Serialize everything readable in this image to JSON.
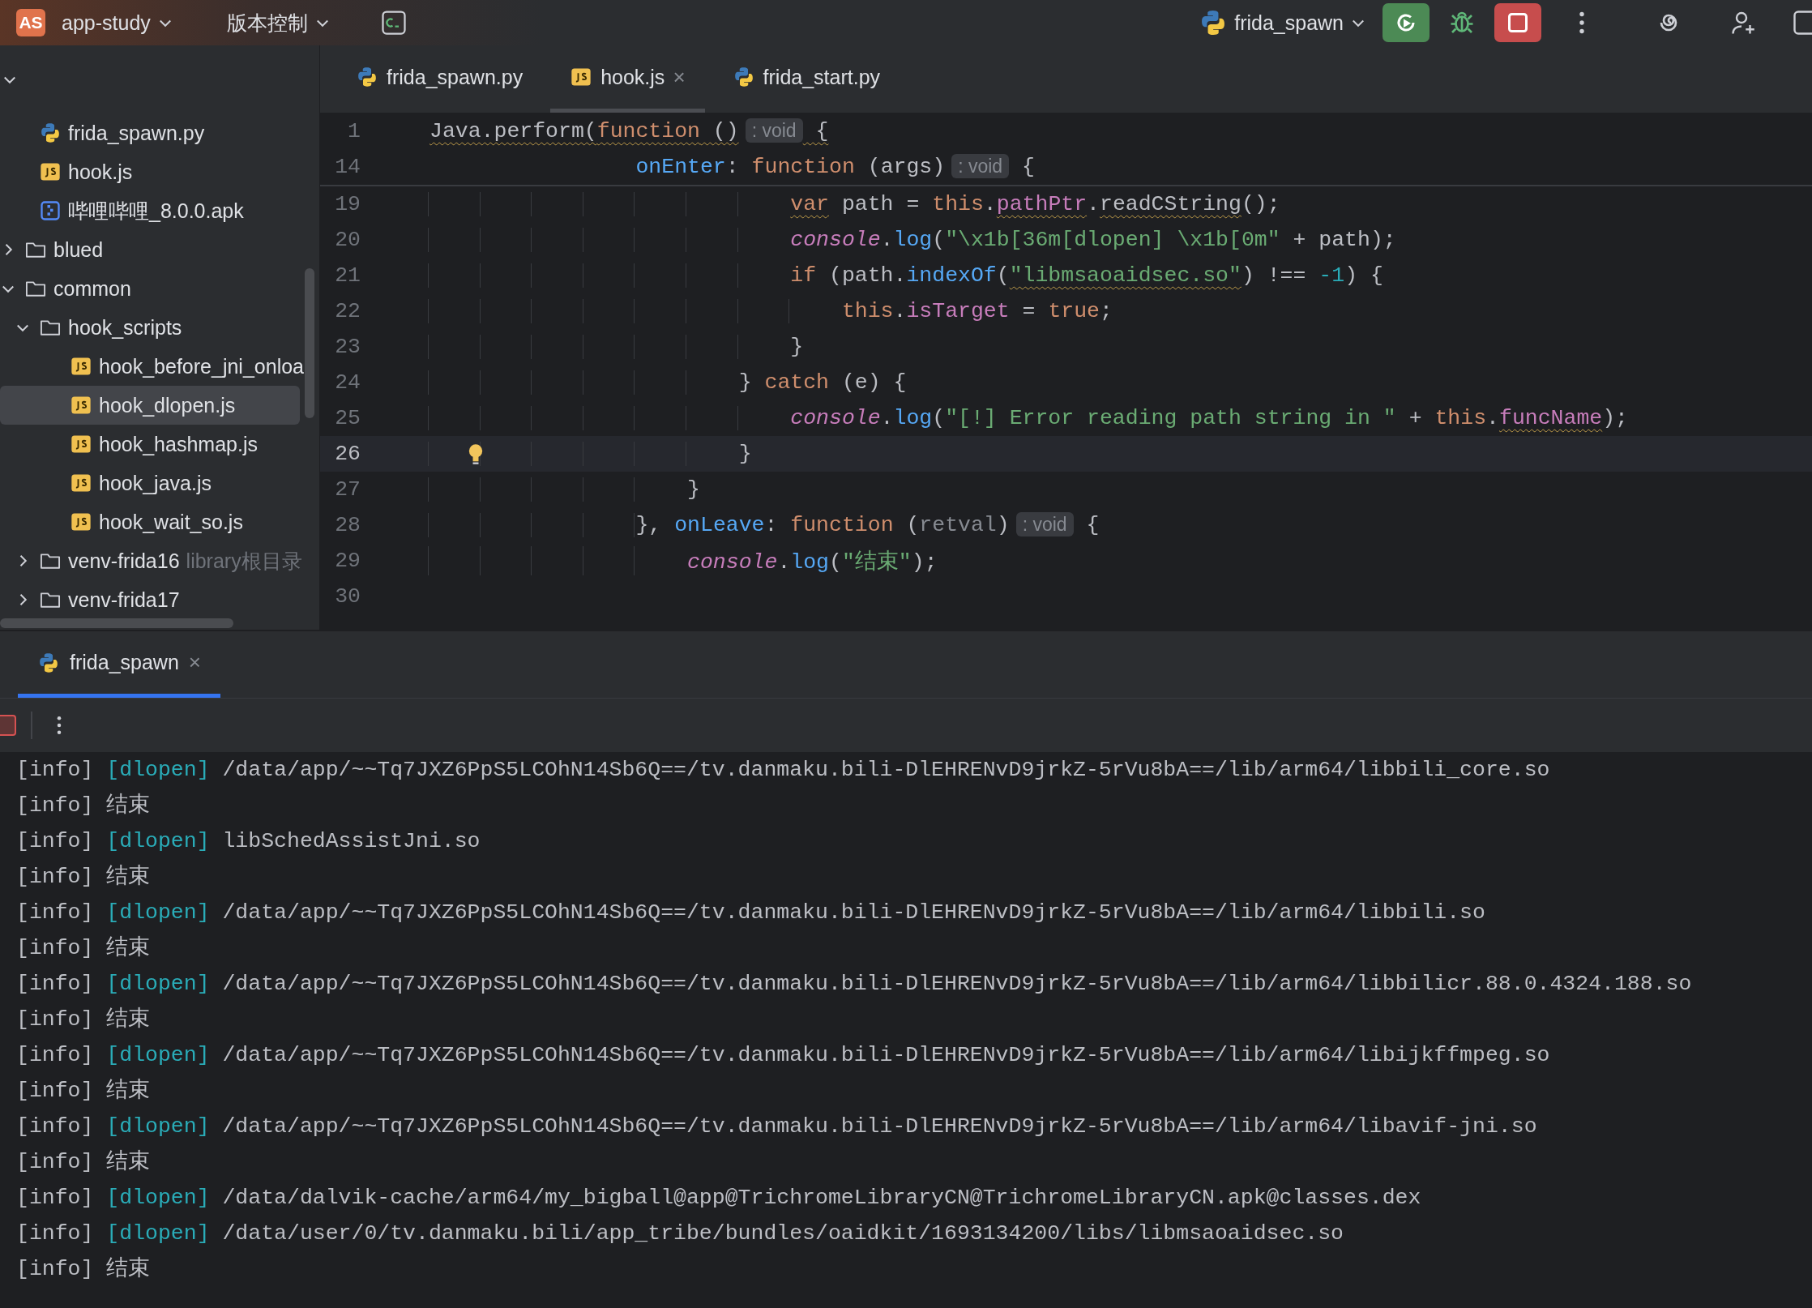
{
  "toolbar": {
    "project_badge": "AS",
    "project": "app-study",
    "vcs": "版本控制",
    "run_config": "frida_spawn"
  },
  "sidebar": {
    "tree": [
      {
        "children": [
          {
            "label": "frida_spawn.py",
            "kind": "python",
            "selected": false
          },
          {
            "label": "hook.js",
            "kind": "js",
            "selected": false
          },
          {
            "label": "哔哩哔哩_8.0.0.apk",
            "kind": "apk",
            "selected": false
          }
        ]
      },
      {
        "label": "blued",
        "kind": "folder",
        "expanded": false,
        "selected": false
      },
      {
        "label": "common",
        "kind": "folder",
        "expanded": true,
        "selected": false,
        "children": [
          {
            "label": "hook_scripts",
            "kind": "folder",
            "expanded": true,
            "selected": false,
            "children": [
              {
                "label": "hook_before_jni_onloa",
                "kind": "js",
                "selected": false
              },
              {
                "label": "hook_dlopen.js",
                "kind": "js",
                "selected": true
              },
              {
                "label": "hook_hashmap.js",
                "kind": "js",
                "selected": false
              },
              {
                "label": "hook_java.js",
                "kind": "js",
                "selected": false
              },
              {
                "label": "hook_wait_so.js",
                "kind": "js",
                "selected": false
              }
            ]
          },
          {
            "label": "venv-frida16",
            "kind": "folder",
            "expanded": false,
            "selected": false,
            "hint": "library根目录"
          },
          {
            "label": "venv-frida17",
            "kind": "folder",
            "expanded": false,
            "selected": false
          }
        ]
      }
    ]
  },
  "editor": {
    "tabs": [
      {
        "label": "frida_spawn.py",
        "kind": "python",
        "selected": false
      },
      {
        "label": "hook.js",
        "kind": "js",
        "selected": true,
        "close": "×"
      },
      {
        "label": "frida_start.py",
        "kind": "python",
        "selected": false
      }
    ],
    "sticky_lines": [
      {
        "number": "1",
        "current": false,
        "segments": [
          {
            "text": "Java.perform(",
            "kind": "plain",
            "squiggly": true
          },
          {
            "text": "function",
            "kind": "keyword",
            "squiggly": true
          },
          {
            "text": " ()",
            "kind": "plain",
            "squiggly": true
          },
          {
            "text": ": void",
            "kind": "hint"
          },
          {
            "text": " {",
            "kind": "plain",
            "squiggly": true
          }
        ]
      },
      {
        "number": "14",
        "current": false,
        "segments": [
          {
            "text": "                onEnter",
            "kind": "function"
          },
          {
            "text": ": ",
            "kind": "plain"
          },
          {
            "text": "function",
            "kind": "keyword"
          },
          {
            "text": " (args)",
            "kind": "plain"
          },
          {
            "text": ": void",
            "kind": "hint"
          },
          {
            "text": " {",
            "kind": "plain"
          }
        ]
      }
    ],
    "lines": [
      {
        "number": "19",
        "current": false,
        "segments": [
          {
            "text": "                            var",
            "kind": "keyword",
            "squiggly": true
          },
          {
            "text": " path = ",
            "kind": "plain"
          },
          {
            "text": "this",
            "kind": "keyword"
          },
          {
            "text": ".",
            "kind": "plain"
          },
          {
            "text": "pathPtr",
            "kind": "property",
            "squiggly": true
          },
          {
            "text": ".",
            "kind": "plain"
          },
          {
            "text": "readCString",
            "kind": "plain",
            "squiggly": true
          },
          {
            "text": "();",
            "kind": "plain"
          }
        ]
      },
      {
        "number": "20",
        "current": false,
        "segments": [
          {
            "text": "                            console",
            "kind": "object"
          },
          {
            "text": ".",
            "kind": "plain"
          },
          {
            "text": "log",
            "kind": "function"
          },
          {
            "text": "(",
            "kind": "plain"
          },
          {
            "text": "\"\\x1b[36m[dlopen] \\x1b[0m\"",
            "kind": "string"
          },
          {
            "text": " + path);",
            "kind": "plain"
          }
        ]
      },
      {
        "number": "21",
        "current": false,
        "segments": [
          {
            "text": "                            if",
            "kind": "keyword"
          },
          {
            "text": " (path.",
            "kind": "plain"
          },
          {
            "text": "indexOf",
            "kind": "function"
          },
          {
            "text": "(",
            "kind": "plain"
          },
          {
            "text": "\"libmsaoaidsec.so\"",
            "kind": "string",
            "squiggly": true
          },
          {
            "text": ") !== ",
            "kind": "plain"
          },
          {
            "text": "-1",
            "kind": "number"
          },
          {
            "text": ") {",
            "kind": "plain"
          }
        ]
      },
      {
        "number": "22",
        "current": false,
        "segments": [
          {
            "text": "                                this",
            "kind": "keyword"
          },
          {
            "text": ".",
            "kind": "plain"
          },
          {
            "text": "isTarget",
            "kind": "property"
          },
          {
            "text": " = ",
            "kind": "plain"
          },
          {
            "text": "true",
            "kind": "keyword"
          },
          {
            "text": ";",
            "kind": "plain"
          }
        ]
      },
      {
        "number": "23",
        "current": false,
        "segments": [
          {
            "text": "                            }",
            "kind": "plain"
          }
        ]
      },
      {
        "number": "24",
        "current": false,
        "segments": [
          {
            "text": "                        } ",
            "kind": "plain"
          },
          {
            "text": "catch",
            "kind": "keyword"
          },
          {
            "text": " (e) {",
            "kind": "plain"
          }
        ]
      },
      {
        "number": "25",
        "current": false,
        "segments": [
          {
            "text": "                            console",
            "kind": "object"
          },
          {
            "text": ".",
            "kind": "plain"
          },
          {
            "text": "log",
            "kind": "function"
          },
          {
            "text": "(",
            "kind": "plain"
          },
          {
            "text": "\"[!] Error reading path string in \"",
            "kind": "string"
          },
          {
            "text": " + ",
            "kind": "plain"
          },
          {
            "text": "this",
            "kind": "keyword"
          },
          {
            "text": ".",
            "kind": "plain"
          },
          {
            "text": "funcName",
            "kind": "property",
            "squiggly": true
          },
          {
            "text": ");",
            "kind": "plain"
          }
        ]
      },
      {
        "number": "26",
        "current": true,
        "segments": [
          {
            "text": "                        }",
            "kind": "plain"
          }
        ]
      },
      {
        "number": "27",
        "current": false,
        "segments": [
          {
            "text": "                    }",
            "kind": "plain"
          }
        ]
      },
      {
        "number": "28",
        "current": false,
        "segments": [
          {
            "text": "                }, ",
            "kind": "plain"
          },
          {
            "text": "onLeave",
            "kind": "function"
          },
          {
            "text": ": ",
            "kind": "plain"
          },
          {
            "text": "function",
            "kind": "keyword"
          },
          {
            "text": " (",
            "kind": "plain"
          },
          {
            "text": "retval",
            "kind": "unused"
          },
          {
            "text": ")",
            "kind": "plain"
          },
          {
            "text": ": void",
            "kind": "hint"
          },
          {
            "text": " {",
            "kind": "plain"
          }
        ]
      },
      {
        "number": "29",
        "current": false,
        "segments": [
          {
            "text": "                    console",
            "kind": "object"
          },
          {
            "text": ".",
            "kind": "plain"
          },
          {
            "text": "log",
            "kind": "function"
          },
          {
            "text": "(",
            "kind": "plain"
          },
          {
            "text": "\"结束\"",
            "kind": "string"
          },
          {
            "text": ");",
            "kind": "plain"
          }
        ]
      },
      {
        "number": "30",
        "current": false
      }
    ]
  },
  "run_panel": {
    "tab": {
      "label": "frida_spawn",
      "selected": true,
      "close": "×"
    },
    "console": [
      {
        "tag": "[info]",
        "source": "[dlopen]",
        "message": "/data/app/~~Tq7JXZ6PpS5LCOhN14Sb6Q==/tv.danmaku.bili-DlEHRENvD9jrkZ-5rVu8bA==/lib/arm64/libbili_core.so"
      },
      {
        "tag": "[info]",
        "message": "结束"
      },
      {
        "tag": "[info]",
        "source": "[dlopen]",
        "message": "libSchedAssistJni.so"
      },
      {
        "tag": "[info]",
        "message": "结束"
      },
      {
        "tag": "[info]",
        "source": "[dlopen]",
        "message": "/data/app/~~Tq7JXZ6PpS5LCOhN14Sb6Q==/tv.danmaku.bili-DlEHRENvD9jrkZ-5rVu8bA==/lib/arm64/libbili.so"
      },
      {
        "tag": "[info]",
        "message": "结束"
      },
      {
        "tag": "[info]",
        "source": "[dlopen]",
        "message": "/data/app/~~Tq7JXZ6PpS5LCOhN14Sb6Q==/tv.danmaku.bili-DlEHRENvD9jrkZ-5rVu8bA==/lib/arm64/libbilicr.88.0.4324.188.so"
      },
      {
        "tag": "[info]",
        "message": "结束"
      },
      {
        "tag": "[info]",
        "source": "[dlopen]",
        "message": "/data/app/~~Tq7JXZ6PpS5LCOhN14Sb6Q==/tv.danmaku.bili-DlEHRENvD9jrkZ-5rVu8bA==/lib/arm64/libijkffmpeg.so"
      },
      {
        "tag": "[info]",
        "message": "结束"
      },
      {
        "tag": "[info]",
        "source": "[dlopen]",
        "message": "/data/app/~~Tq7JXZ6PpS5LCOhN14Sb6Q==/tv.danmaku.bili-DlEHRENvD9jrkZ-5rVu8bA==/lib/arm64/libavif-jni.so"
      },
      {
        "tag": "[info]",
        "message": "结束"
      },
      {
        "tag": "[info]",
        "source": "[dlopen]",
        "message": "/data/dalvik-cache/arm64/my_bigball@app@TrichromeLibraryCN@TrichromeLibraryCN.apk@classes.dex"
      },
      {
        "tag": "[info]",
        "source": "[dlopen]",
        "message": "/data/user/0/tv.danmaku.bili/app_tribe/bundles/oaidkit/1693134200/libs/libmsaoaidsec.so"
      },
      {
        "tag": "[info]",
        "message": "结束"
      }
    ]
  }
}
